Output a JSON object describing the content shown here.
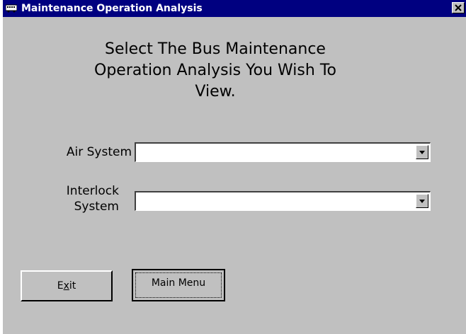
{
  "window": {
    "title": "Maintenance Operation Analysis",
    "close_label": "×"
  },
  "heading": {
    "line1": "Select The Bus Maintenance",
    "line2": "Operation Analysis You Wish To",
    "line3": "View."
  },
  "fields": {
    "air_system": {
      "label": "Air System",
      "value": ""
    },
    "interlock_system": {
      "label_line1": "Interlock",
      "label_line2": "System",
      "value": ""
    }
  },
  "buttons": {
    "exit_label_pre": "E",
    "exit_label_accel": "x",
    "exit_label_post": "it",
    "main_menu_label": "Main Menu"
  },
  "colors": {
    "titlebar": "#000080",
    "face": "#c0c0c0"
  },
  "icons": {
    "title": "bus-icon",
    "close": "close-icon",
    "dropdown": "dropdown-arrow-icon"
  }
}
